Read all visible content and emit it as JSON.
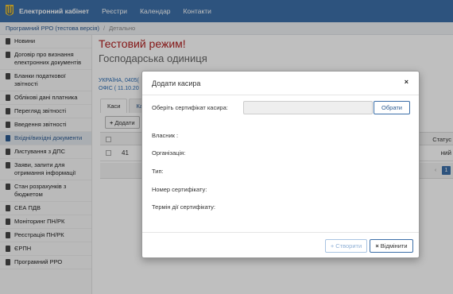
{
  "navbar": {
    "brand": "Електронний кабінет",
    "links": [
      "Реєстри",
      "Календар",
      "Контакти"
    ]
  },
  "breadcrumb": {
    "section": "Програмний РРО (тестова версія)",
    "current": "Детально"
  },
  "sidebar": {
    "items": [
      {
        "label": "Новини",
        "icon": "document-icon"
      },
      {
        "label": "Договір про визнання електронних документів",
        "icon": "document-icon"
      },
      {
        "label": "Бланки податкової звітності",
        "icon": "document-icon"
      },
      {
        "label": "Облікові дані платника",
        "icon": "user-icon"
      },
      {
        "label": "Перегляд звітності",
        "icon": "list-icon"
      },
      {
        "label": "Введення звітності",
        "icon": "edit-icon"
      },
      {
        "label": "Вхідні/вихідні документи",
        "icon": "inbox-icon"
      },
      {
        "label": "Листування з ДПС",
        "icon": "mail-icon"
      },
      {
        "label": "Заяви, запити для отримання інформації",
        "icon": "share-icon"
      },
      {
        "label": "Стан розрахунків з бюджетом",
        "icon": "bank-icon"
      },
      {
        "label": "СЕА ПДВ",
        "icon": "arrows-icon"
      },
      {
        "label": "Моніторинг ПН/РК",
        "icon": "monitor-icon"
      },
      {
        "label": "Реєстрація ПН/РК",
        "icon": "register-icon"
      },
      {
        "label": "ЄРПН",
        "icon": "registry-icon"
      },
      {
        "label": "Програмний РРО",
        "icon": "cash-register-icon"
      }
    ]
  },
  "main": {
    "test_mode": "Тестовий режим!",
    "title": "Господарська одиниця",
    "info_line1": "УКРАЇНА, 0405(",
    "info_line2": "ОФІС ( 11.10.20",
    "tabs": [
      "Каси",
      "Ка"
    ],
    "add_button": "Додати",
    "status_header": "Статус",
    "row": {
      "id": "41",
      "status": "ний"
    },
    "pager": {
      "prev": "‹",
      "page": "1"
    }
  },
  "modal": {
    "title": "Додати касира",
    "close": "×",
    "cert_label": "Оберіть сертифікат касира:",
    "choose_button": "Обрати",
    "owner_label": "Власник :",
    "org_label": "Організація:",
    "type_label": "Тип:",
    "cert_number_label": "Номер сертифікату:",
    "cert_validity_label": "Термін дії сертифікату:",
    "create_button": "Створити",
    "cancel_button": "Відмінити"
  },
  "colors": {
    "navbar": "#3c6fa8",
    "test_mode": "#b22222",
    "link": "#2b5a91"
  }
}
